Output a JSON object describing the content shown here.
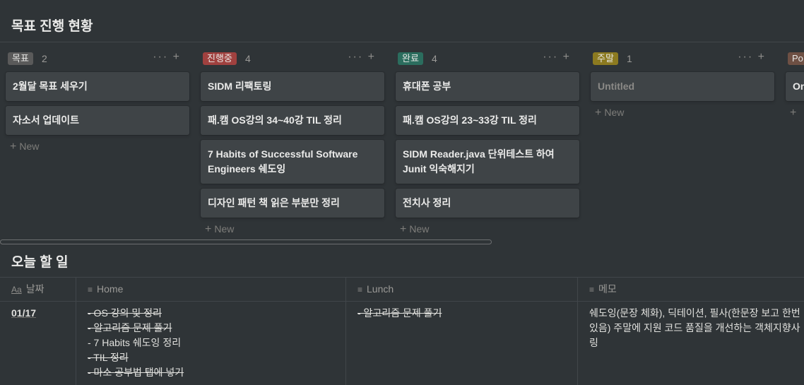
{
  "header": {
    "title": "목표 진행 현황"
  },
  "columns": [
    {
      "tag": "목표",
      "color": "#5a5a5a",
      "count": "2",
      "cards": [
        "2월달 목표 세우기",
        "자소서 업데이트"
      ],
      "new_label": "New"
    },
    {
      "tag": "진행중",
      "color": "#a0413f",
      "count": "4",
      "cards": [
        "SIDM 리팩토링",
        "패.캠 OS강의 34~40강 TIL 정리",
        "7 Habits of Successful Software Engineers 쉐도잉",
        "디자인 패턴 책 읽은 부분만 정리"
      ],
      "new_label": "New"
    },
    {
      "tag": "완료",
      "color": "#2b6d5e",
      "count": "4",
      "cards": [
        "휴대폰 공부",
        "패.캠 OS강의 23~33강 TIL 정리",
        "SIDM Reader.java 단위테스트 하여 Junit 익숙해지기",
        "전치사 정리"
      ],
      "new_label": "New"
    },
    {
      "tag": "주말",
      "color": "#8c7a20",
      "count": "1",
      "cards": [
        "Untitled"
      ],
      "new_label": "New"
    },
    {
      "tag": "Po",
      "color": "#6e5044",
      "count": "",
      "cards": [
        "On"
      ],
      "new_label": ""
    }
  ],
  "col_actions": "··· +",
  "today": {
    "title": "오늘 할 일",
    "headers": {
      "date": "날짜",
      "home": "Home",
      "lunch": "Lunch",
      "memo": "메모"
    },
    "header_icons": {
      "date": "Aa",
      "text": "≡"
    },
    "row": {
      "date": "01/17",
      "home": [
        {
          "text": "- OS 강의 및 정리",
          "done": true
        },
        {
          "text": "- 알고리즘 문제 풀기",
          "done": true
        },
        {
          "text": "- 7 Habits 쉐도잉 정리",
          "done": false
        },
        {
          "text": "- TIL 정리",
          "done": true
        },
        {
          "text": "- 마소 공부법 탭에 넣기",
          "done": true
        }
      ],
      "lunch": [
        {
          "text": "- 알고리즘 문제 풀기",
          "done": true
        }
      ],
      "memo": "쉐도잉(문장 체화), 딕테이션, 필사(한문장 보고 한번 있음) 주말에 지원 코드 품질을 개선하는 객체지향사 링"
    }
  }
}
